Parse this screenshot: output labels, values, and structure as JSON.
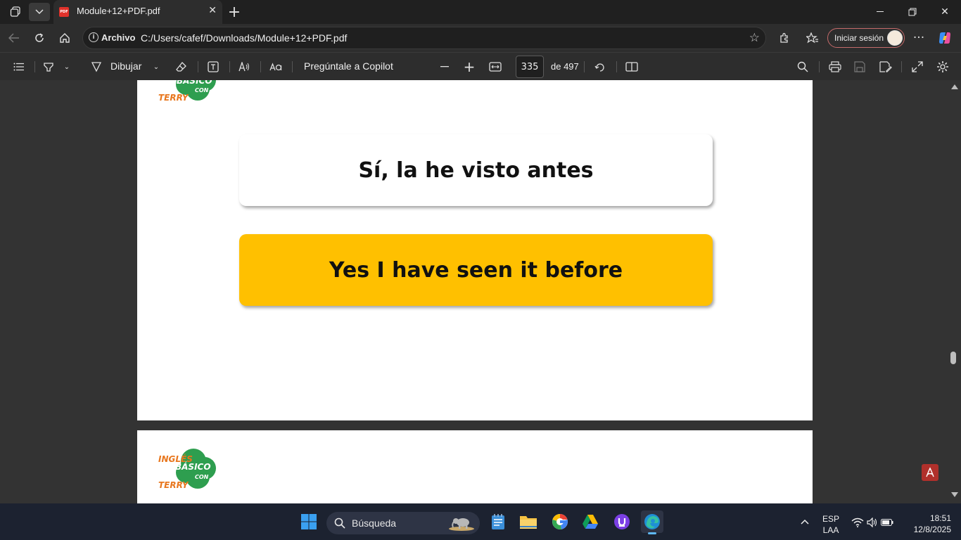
{
  "browser": {
    "tab_title": "Module+12+PDF.pdf",
    "address_label": "Archivo",
    "url": "C:/Users/cafef/Downloads/Module+12+PDF.pdf",
    "signin_label": "Iniciar sesión"
  },
  "pdf_toolbar": {
    "draw_label": "Dibujar",
    "copilot_label": "Pregúntale a Copilot",
    "page_number": "335",
    "page_total": "de 497"
  },
  "document": {
    "card_spanish": "Sí, la he visto antes",
    "card_english": "Yes I have seen it before",
    "logo_line1": "INGLÉS",
    "logo_line2": "BÁSICO",
    "logo_line3": "CON",
    "logo_line4": "TERRY",
    "colors": {
      "card_english_bg": "#FFC000",
      "card_spanish_bg": "#FFFFFF",
      "logo_green": "#2E9E4F",
      "logo_orange": "#E8771E"
    }
  },
  "taskbar": {
    "search_placeholder": "Búsqueda",
    "lang_line1": "ESP",
    "lang_line2": "LAA",
    "time": "18:51",
    "date": "12/8/2025"
  }
}
